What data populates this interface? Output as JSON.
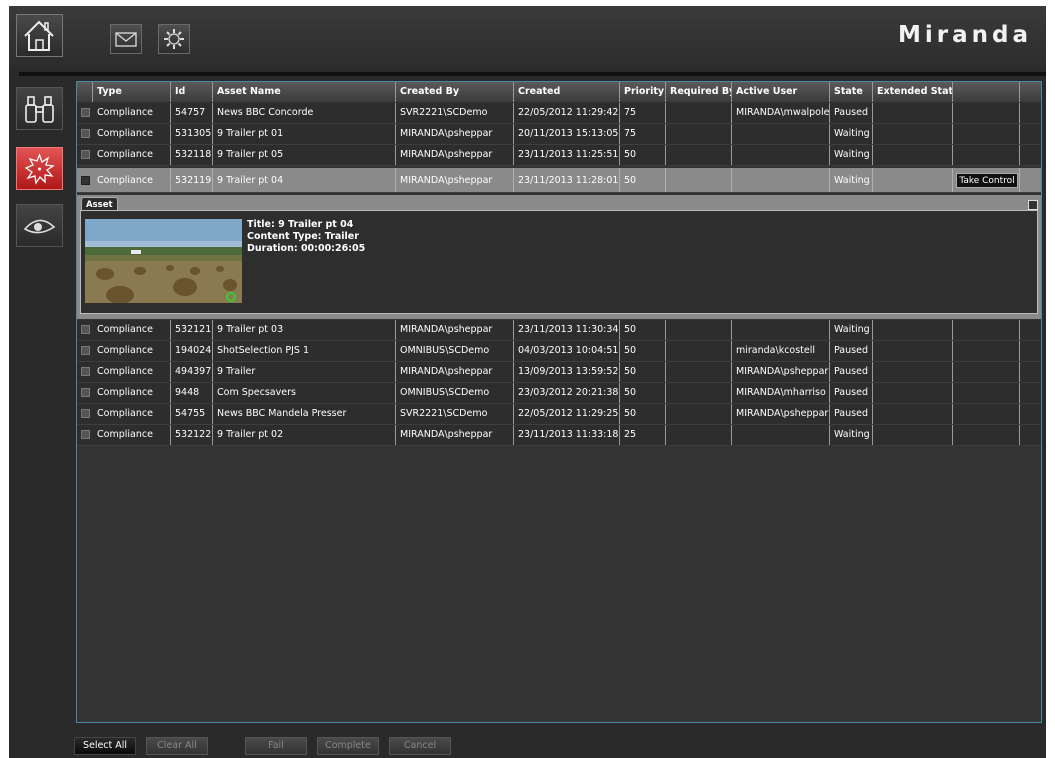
{
  "brand": {
    "logo_text": "Miranda"
  },
  "toolbar": {
    "home_icon": "home-icon",
    "mail_icon": "envelope-icon",
    "settings_icon": "gear-icon"
  },
  "sidebar": {
    "items": [
      {
        "icon": "binoculars-icon",
        "active": false
      },
      {
        "icon": "alert-burst-icon",
        "active": true
      },
      {
        "icon": "eye-icon",
        "active": false
      }
    ]
  },
  "table": {
    "columns": [
      "Type",
      "Id",
      "Asset Name",
      "Created By",
      "Created",
      "Priority",
      "Required By",
      "Active User",
      "State",
      "Extended State"
    ],
    "rows_top": [
      {
        "type": "Compliance",
        "id": "54757",
        "asset": "News BBC Concorde",
        "created_by": "SVR2221\\SCDemo",
        "created": "22/05/2012 11:29:42",
        "priority": "75",
        "required_by": "",
        "active_user": "MIRANDA\\mwalpole",
        "state": "Paused",
        "ext": ""
      },
      {
        "type": "Compliance",
        "id": "531305",
        "asset": "9 Trailer pt 01",
        "created_by": "MIRANDA\\psheppar",
        "created": "20/11/2013 15:13:05",
        "priority": "75",
        "required_by": "",
        "active_user": "",
        "state": "Waiting",
        "ext": ""
      },
      {
        "type": "Compliance",
        "id": "532118",
        "asset": "9 Trailer pt 05",
        "created_by": "MIRANDA\\psheppar",
        "created": "23/11/2013 11:25:51",
        "priority": "50",
        "required_by": "",
        "active_user": "",
        "state": "Waiting",
        "ext": ""
      }
    ],
    "selected_row": {
      "type": "Compliance",
      "id": "532119",
      "asset": "9 Trailer pt 04",
      "created_by": "MIRANDA\\psheppar",
      "created": "23/11/2013 11:28:01",
      "priority": "50",
      "required_by": "",
      "active_user": "",
      "state": "Waiting",
      "ext": "",
      "action_label": "Take Control"
    },
    "rows_bottom": [
      {
        "type": "Compliance",
        "id": "532121",
        "asset": "9 Trailer pt 03",
        "created_by": "MIRANDA\\psheppar",
        "created": "23/11/2013 11:30:34",
        "priority": "50",
        "required_by": "",
        "active_user": "",
        "state": "Waiting",
        "ext": ""
      },
      {
        "type": "Compliance",
        "id": "194024",
        "asset": "ShotSelection PJS 1",
        "created_by": "OMNIBUS\\SCDemo",
        "created": "04/03/2013 10:04:51",
        "priority": "50",
        "required_by": "",
        "active_user": "miranda\\kcostell",
        "state": "Paused",
        "ext": ""
      },
      {
        "type": "Compliance",
        "id": "494397",
        "asset": "9 Trailer",
        "created_by": "MIRANDA\\psheppar",
        "created": "13/09/2013 13:59:52",
        "priority": "50",
        "required_by": "",
        "active_user": "MIRANDA\\psheppar",
        "state": "Paused",
        "ext": ""
      },
      {
        "type": "Compliance",
        "id": "9448",
        "asset": "Com Specsavers",
        "created_by": "OMNIBUS\\SCDemo",
        "created": "23/03/2012 20:21:38",
        "priority": "50",
        "required_by": "",
        "active_user": "MIRANDA\\mharriso",
        "state": "Paused",
        "ext": ""
      },
      {
        "type": "Compliance",
        "id": "54755",
        "asset": "News BBC Mandela Presser",
        "created_by": "SVR2221\\SCDemo",
        "created": "22/05/2012 11:29:25",
        "priority": "50",
        "required_by": "",
        "active_user": "MIRANDA\\psheppar",
        "state": "Paused",
        "ext": ""
      },
      {
        "type": "Compliance",
        "id": "532122",
        "asset": "9 Trailer pt 02",
        "created_by": "MIRANDA\\psheppar",
        "created": "23/11/2013 11:33:18",
        "priority": "25",
        "required_by": "",
        "active_user": "",
        "state": "Waiting",
        "ext": ""
      }
    ]
  },
  "detail": {
    "tab_label": "Asset",
    "title_line": "Title: 9 Trailer pt 04",
    "content_type_line": "Content Type: Trailer",
    "duration_line": "Duration: 00:00:26:05"
  },
  "footer": {
    "select_all": "Select All",
    "clear_all": "Clear All",
    "fail": "Fail",
    "complete": "Complete",
    "cancel": "Cancel"
  }
}
